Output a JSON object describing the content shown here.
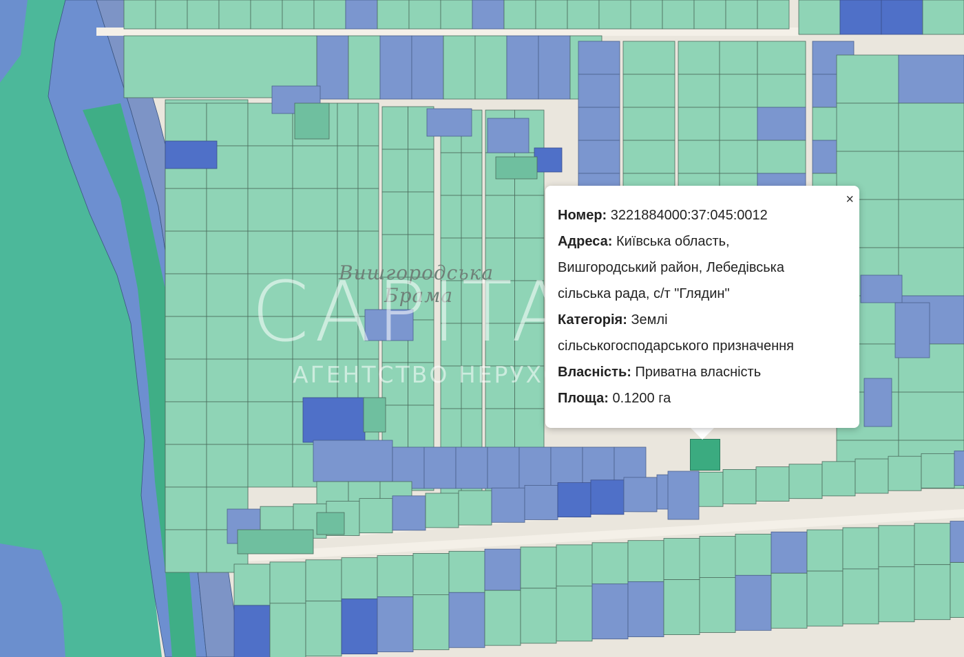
{
  "map": {
    "area_label_line1": "Вишгородська",
    "area_label_line2": "Брама",
    "watermark_main": "CAPITAL",
    "watermark_sub": "АГЕНТСТВО НЕРУХОМОСТІ",
    "colors": {
      "water": "#4cb89a",
      "road": "#eae6dd",
      "parcel_green": "#8fd4b6",
      "parcel_blue": "#7b96cf",
      "parcel_dark_blue": "#4f70c8",
      "selected_parcel": "#3bab80"
    }
  },
  "popup": {
    "close_icon": "×",
    "number_label": "Номер:",
    "number_value": "3221884000:37:045:0012",
    "address_label": "Адреса:",
    "address_value_1": "Київська область,",
    "address_value_2": "Вишгородський район, Лебедівська",
    "address_value_3": "сільська рада, с/т \"Глядин\"",
    "category_label": "Категорія:",
    "category_value_1": "Землі",
    "category_value_2": "сільськогосподарського призначення",
    "ownership_label": "Власність:",
    "ownership_value": "Приватна власність",
    "area_label": "Площа:",
    "area_value": "0.1200 га"
  }
}
